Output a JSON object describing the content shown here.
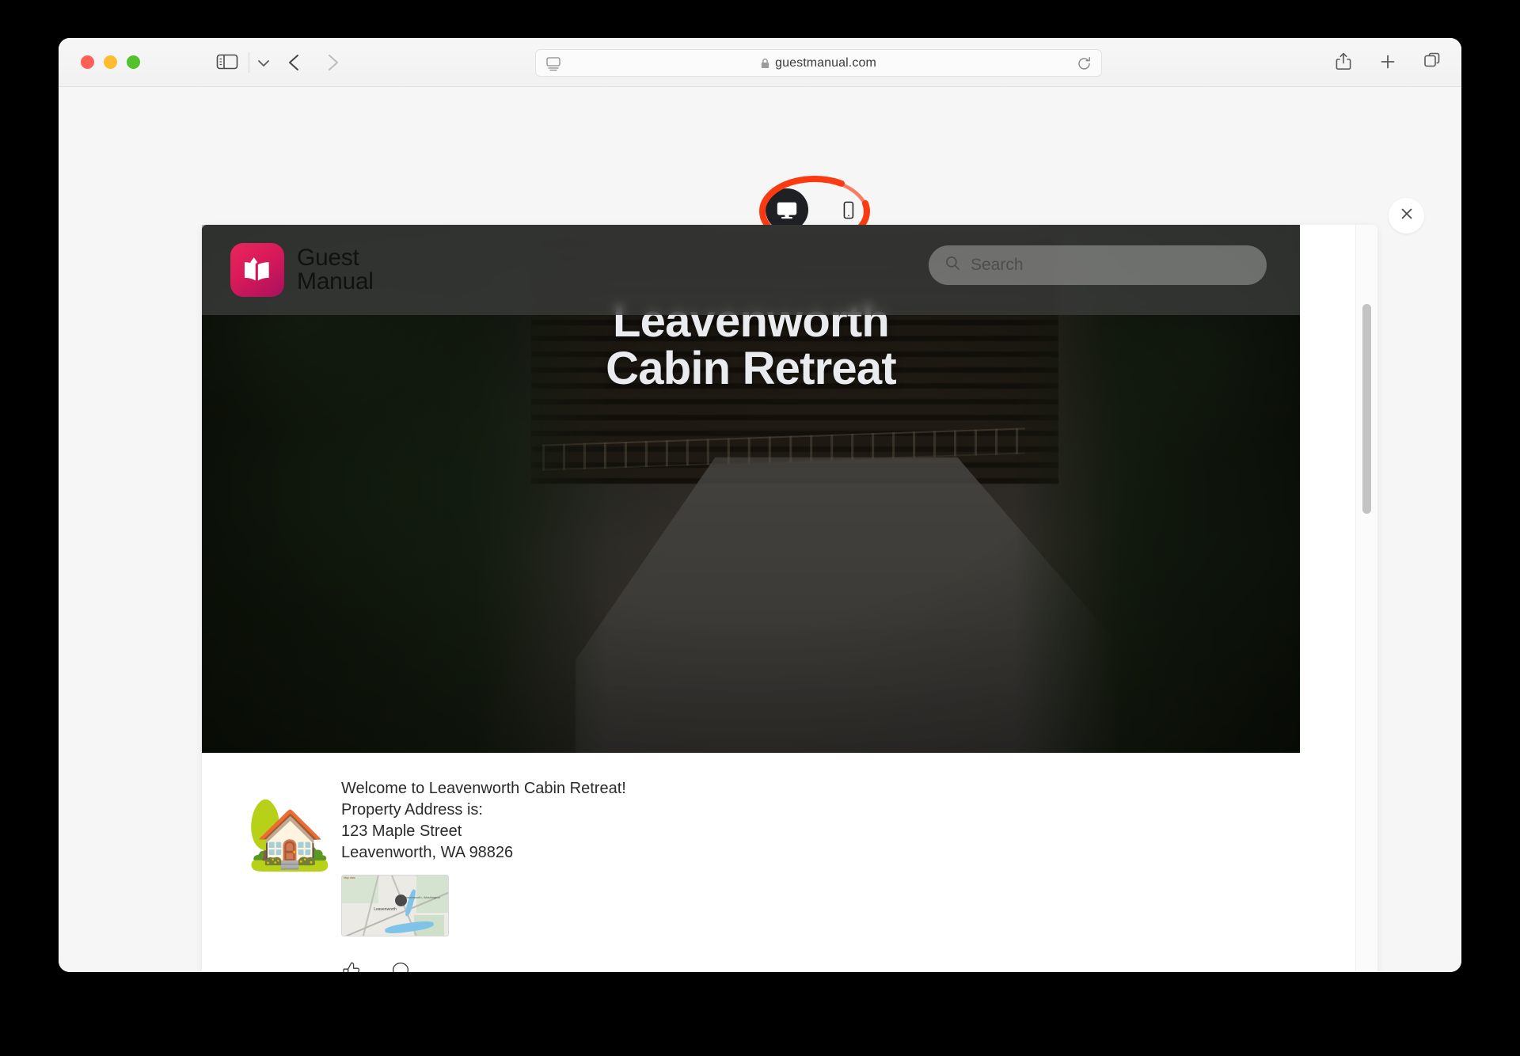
{
  "browser": {
    "window_controls": [
      {
        "name": "close",
        "color": "#ff5f57"
      },
      {
        "name": "minimize",
        "color": "#febc2e"
      },
      {
        "name": "zoom",
        "color": "#53c22b"
      }
    ],
    "sidebar_icon": "sidebar-icon",
    "dropdown_icon": "chevron-down-icon",
    "back_icon": "chevron-left-icon",
    "forward_icon": "chevron-right-icon",
    "url": "guestmanual.com",
    "url_lock_icon": "lock-icon",
    "url_reader_icon": "reader-view-icon",
    "reload_icon": "reload-icon",
    "share_icon": "share-icon",
    "new_tab_icon": "plus-icon",
    "tab_overview_icon": "tab-overview-icon"
  },
  "responsive_mode": {
    "desktop_icon": "desktop-monitor-icon",
    "mobile_icon": "mobile-phone-icon",
    "desktop_selected": true,
    "close_icon": "close-x-icon",
    "annotation_color": "#fb3b12"
  },
  "site": {
    "brand": {
      "logo_icon": "open-book-icon",
      "logo_color": "#d81a59",
      "line1": "Guest",
      "line2": "Manual"
    },
    "search": {
      "icon": "search-icon",
      "placeholder": "Search",
      "value": ""
    },
    "hero": {
      "title_line1": "Leavenworth",
      "title_line2": "Cabin Retreat"
    },
    "post": {
      "avatar_emoji": "🏡",
      "lines": [
        "Welcome to Leavenworth Cabin Retreat!",
        "Property Address is:",
        "123 Maple Street",
        "Leavenworth, WA 98826"
      ],
      "map": {
        "city_label": "Leavenworth",
        "state_label": "Leavenworth, Washington",
        "attribution": "Map data"
      },
      "actions": [
        {
          "name": "like",
          "icon": "thumbs-up-icon"
        },
        {
          "name": "comment",
          "icon": "speech-bubble-icon"
        }
      ]
    },
    "scrollbar": {
      "name": "preview-scrollbar"
    }
  }
}
